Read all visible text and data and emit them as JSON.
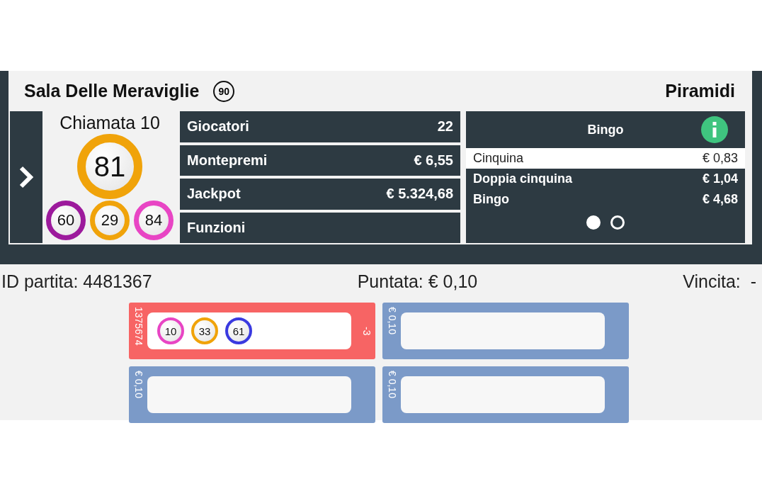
{
  "room": {
    "name": "Sala Delle Meraviglie",
    "badge": "90",
    "game": "Piramidi"
  },
  "call": {
    "label": "Chiamata 10",
    "current": {
      "number": "81",
      "color": "#f0a30a"
    },
    "previous": [
      {
        "number": "60",
        "color": "#9c1a9c"
      },
      {
        "number": "29",
        "color": "#f0a30a"
      },
      {
        "number": "84",
        "color": "#e845c4"
      }
    ]
  },
  "stats": [
    {
      "label": "Giocatori",
      "value": "22"
    },
    {
      "label": "Montepremi",
      "value": "€ 6,55"
    },
    {
      "label": "Jackpot",
      "value": "€ 5.324,68"
    },
    {
      "label": "Funzioni"
    }
  ],
  "prizes": {
    "title": "Bingo",
    "rows": [
      {
        "name": "Cinquina",
        "amount": "€ 0,83",
        "selected": true
      },
      {
        "name": "Doppia cinquina",
        "amount": "€ 1,04",
        "selected": false
      },
      {
        "name": "Bingo",
        "amount": "€ 4,68",
        "selected": false
      }
    ],
    "pages": [
      {
        "selected": true
      },
      {
        "selected": false
      }
    ]
  },
  "info": {
    "game_id": "ID partita: 4481367",
    "bet": "Puntata: € 0,10",
    "win": "Vincita:  -"
  },
  "tickets": [
    {
      "kind": "playing",
      "side": "1375674",
      "missing": "-3",
      "balls": [
        {
          "number": "10",
          "color": "#e845c4"
        },
        {
          "number": "33",
          "color": "#f0a30a"
        },
        {
          "number": "61",
          "color": "#3a3ae0"
        }
      ]
    },
    {
      "kind": "waiting",
      "side": "€ 0,10"
    },
    {
      "kind": "waiting",
      "side": "€ 0,10"
    },
    {
      "kind": "waiting",
      "side": "€ 0,10"
    }
  ]
}
